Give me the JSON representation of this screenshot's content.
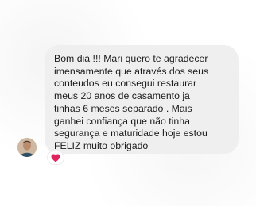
{
  "message": {
    "lines": [
      "Bom dia !!! Mari quero te agradecer",
      "imensamente que através dos seus",
      "conteudos eu consegui restaurar",
      "meus 20 anos de casamento ja",
      "tinhas 6 meses separado . Mais",
      "ganhei confiança  que não  tinha",
      "segurança e maturidade hoje estou",
      "FELIZ muito obrigado"
    ]
  },
  "sender": {
    "avatar_icon": "profile-photo-avatar"
  },
  "reaction": {
    "icon": "heart-icon",
    "color": "#e0245e"
  },
  "colors": {
    "bubble_background": "#efefef",
    "text": "#1b1b1b"
  }
}
